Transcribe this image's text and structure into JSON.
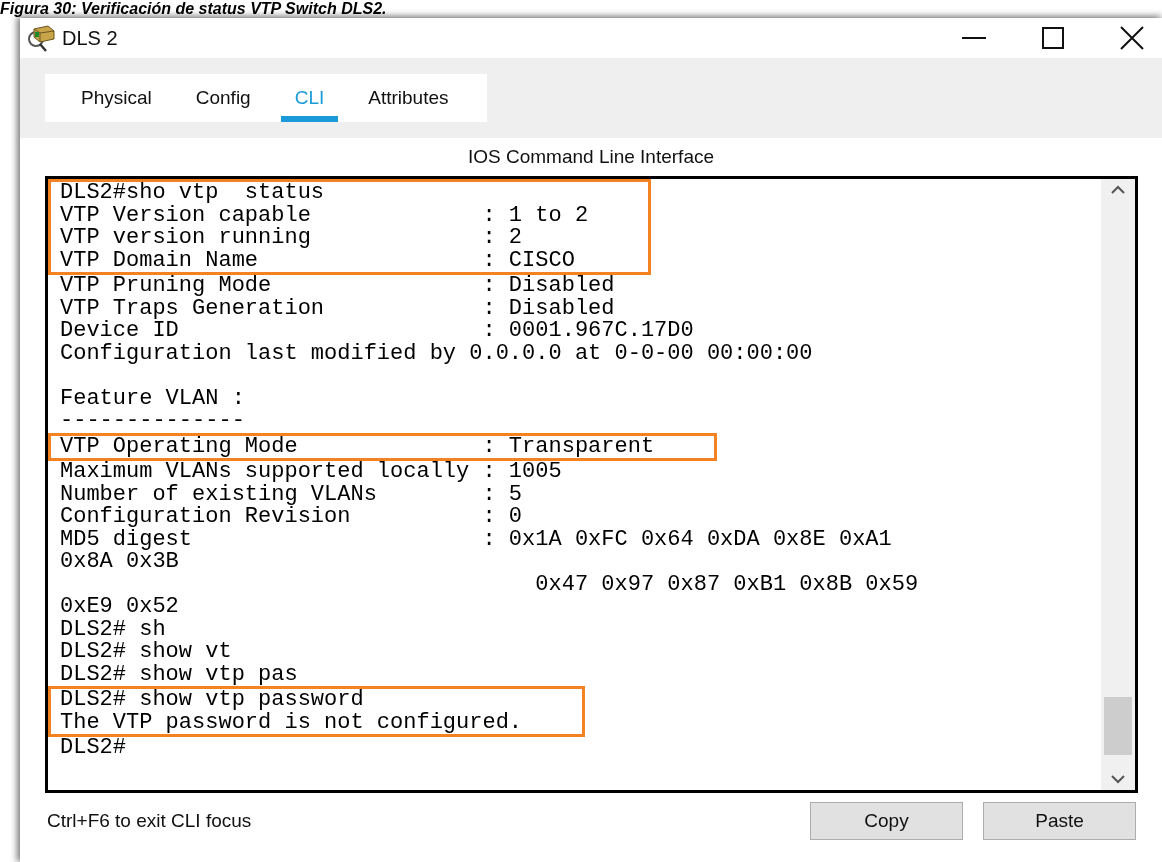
{
  "caption": "Figura 30: Verificación de status VTP Switch DLS2.",
  "window": {
    "title": "DLS 2"
  },
  "tabs": [
    {
      "label": "Physical",
      "selected": false
    },
    {
      "label": "Config",
      "selected": false
    },
    {
      "label": "CLI",
      "selected": true
    },
    {
      "label": "Attributes",
      "selected": false
    }
  ],
  "panel_title": "IOS Command Line Interface",
  "terminal": {
    "lines": [
      {
        "kind": "text",
        "text": "DLS2#sho vtp  status",
        "highlighted": true
      },
      {
        "kind": "text",
        "text": "VTP Version capable             : 1 to 2",
        "highlighted": true
      },
      {
        "kind": "text",
        "text": "VTP version running             : 2",
        "highlighted": true
      },
      {
        "kind": "text",
        "text": "VTP Domain Name                 : CISCO",
        "highlighted": true
      },
      {
        "kind": "text",
        "text": "VTP Pruning Mode                : Disabled",
        "highlighted": false
      },
      {
        "kind": "text",
        "text": "VTP Traps Generation            : Disabled",
        "highlighted": false
      },
      {
        "kind": "text",
        "text": "Device ID                       : 0001.967C.17D0",
        "highlighted": false
      },
      {
        "kind": "text",
        "text": "Configuration last modified by 0.0.0.0 at 0-0-00 00:00:00",
        "highlighted": false
      },
      {
        "kind": "blank"
      },
      {
        "kind": "text",
        "text": "Feature VLAN :",
        "highlighted": false
      },
      {
        "kind": "text",
        "text": "--------------",
        "highlighted": false
      },
      {
        "kind": "text",
        "text": "VTP Operating Mode              : Transparent",
        "highlighted": true
      },
      {
        "kind": "text",
        "text": "Maximum VLANs supported locally : 1005",
        "highlighted": false
      },
      {
        "kind": "text",
        "text": "Number of existing VLANs        : 5",
        "highlighted": false
      },
      {
        "kind": "text",
        "text": "Configuration Revision          : 0",
        "highlighted": false
      },
      {
        "kind": "text",
        "text": "MD5 digest                      : 0x1A 0xFC 0x64 0xDA 0x8E 0xA1",
        "highlighted": false
      },
      {
        "kind": "text",
        "text": "0x8A 0x3B",
        "highlighted": false
      },
      {
        "kind": "text",
        "text": "                                    0x47 0x97 0x87 0xB1 0x8B 0x59",
        "highlighted": false
      },
      {
        "kind": "text",
        "text": "0xE9 0x52",
        "highlighted": false
      },
      {
        "kind": "text",
        "text": "DLS2# sh",
        "highlighted": false
      },
      {
        "kind": "text",
        "text": "DLS2# show vt",
        "highlighted": false
      },
      {
        "kind": "text",
        "text": "DLS2# show vtp pas",
        "highlighted": false
      },
      {
        "kind": "text",
        "text": "DLS2# show vtp password",
        "highlighted": true
      },
      {
        "kind": "text",
        "text": "The VTP password is not configured.",
        "highlighted": true
      },
      {
        "kind": "text",
        "text": "DLS2#",
        "highlighted": false
      }
    ]
  },
  "footer": {
    "hint": "Ctrl+F6 to exit CLI focus",
    "buttons": [
      "Copy",
      "Paste"
    ]
  }
}
